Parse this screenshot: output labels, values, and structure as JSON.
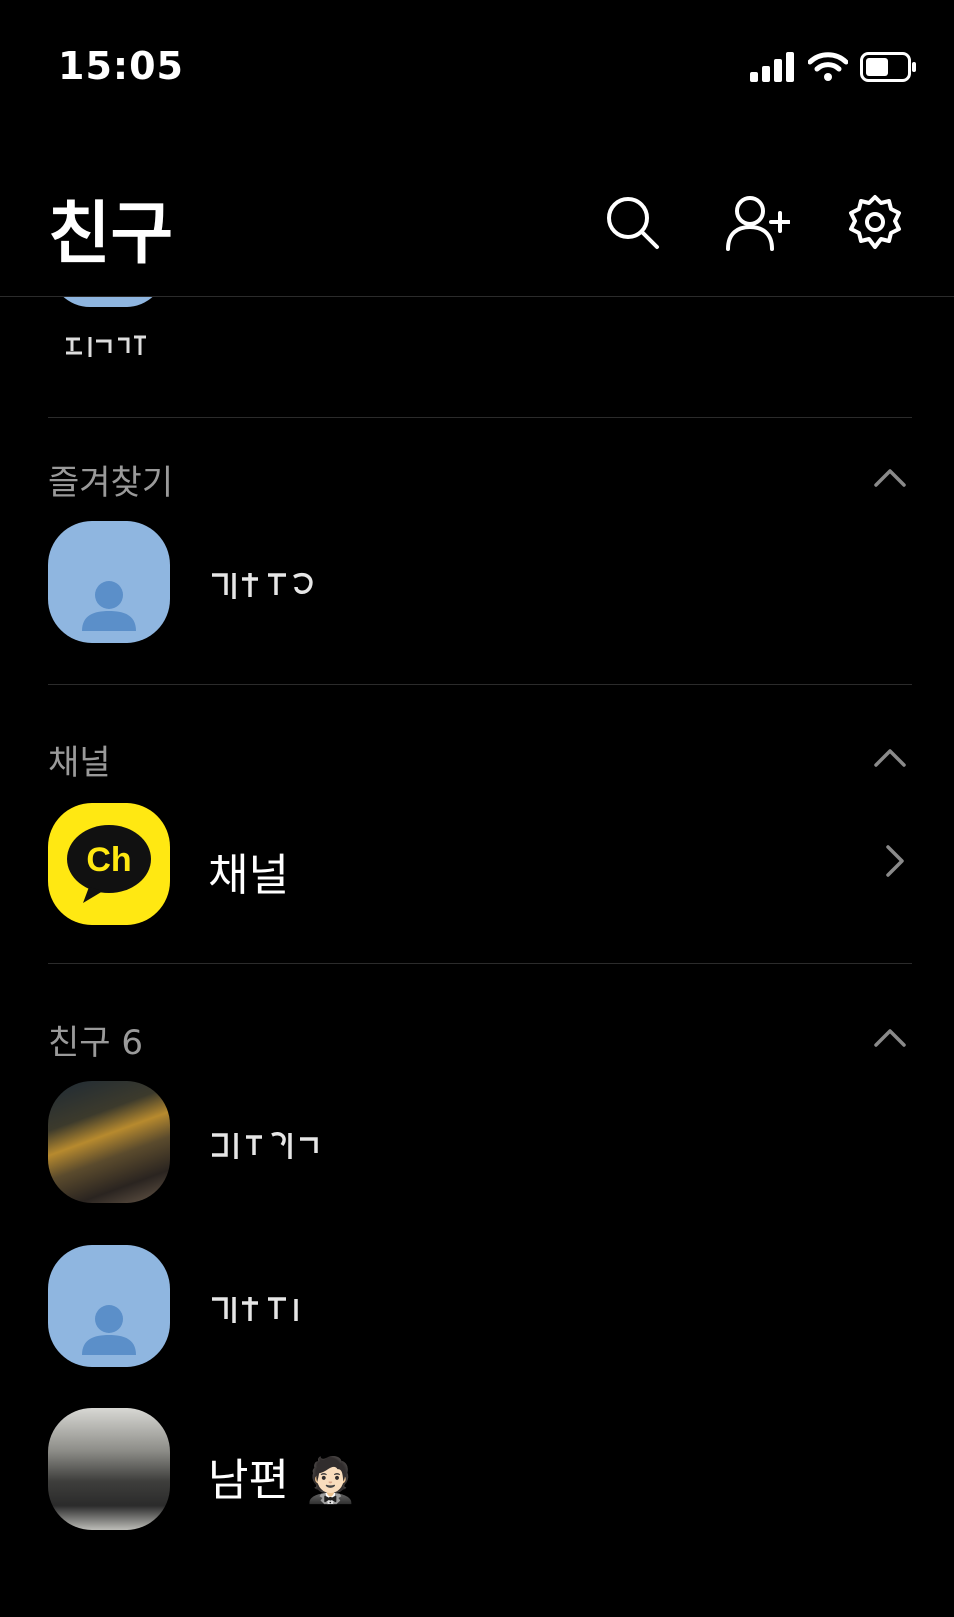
{
  "status_bar": {
    "time": "15:05",
    "battery_level": 0.5
  },
  "header": {
    "title": "친구",
    "icons": [
      "search-icon",
      "add-friend-icon",
      "settings-icon"
    ]
  },
  "sections": {
    "favorites": {
      "title": "즐겨찾기"
    },
    "channels": {
      "title": "채널",
      "item_label": "채널",
      "logo_text": "Ch"
    },
    "friends": {
      "title": "친구 6",
      "friend3_name": "남편 🤵🏻"
    }
  },
  "colors": {
    "background": "#000000",
    "default_avatar": "#8fb6e0",
    "channel_yellow": "#ffe812",
    "section_title": "#9a9a9a",
    "divider": "#2b2b2b"
  }
}
